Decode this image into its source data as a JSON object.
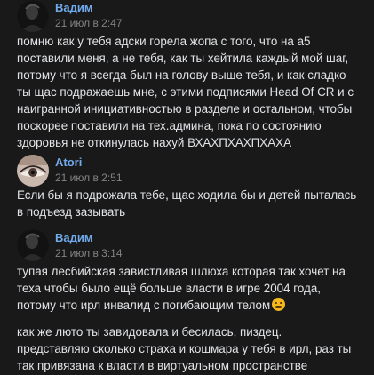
{
  "messages": [
    {
      "author": "Вадим",
      "time": "21 июл в 2:47",
      "avatar_icon": "dark-portrait-avatar",
      "lines": [
        "помню как у тебя адски горела жопа с того, что на а5",
        "поставили меня, а не тебя, как ты хейтила каждый мой шаг,",
        "потому что я всегда был на голову выше тебя, и как сладко",
        "ты щас подражаешь мне, с этими подписями Head Of CR и с",
        "наигранной инициативностью в разделе и остальном, чтобы",
        "поскорее поставили на тех.админа, пока по состоянию",
        "здоровья не откинулась нахуй ВХАХПХАХПХАХА"
      ]
    },
    {
      "author": "Atori",
      "time": "21 июл в 2:51",
      "avatar_icon": "eye-closeup-avatar",
      "lines": [
        "Если бы я подрожала тебе, щас ходила бы и детей пыталась",
        "в подъезд зазывать"
      ]
    },
    {
      "author": "Вадим",
      "time": "21 июл в 3:14",
      "avatar_icon": "dark-portrait-avatar",
      "lines": [
        "тупая лесбийская завистливая шлюха которая так хочет на",
        "теха чтобы было ещё больше власти в игре 2004 года,",
        "потому что ирл инвалид с погибающим телом"
      ],
      "emoji": "grimacing-face-emoji",
      "lines2": [
        "как же люто ты завидовала и бесилась, пиздец.",
        "представляю сколько страха и кошмара у тебя в ирл, раз ты",
        "так привязана к власти в виртуальном пространстве"
      ]
    }
  ]
}
